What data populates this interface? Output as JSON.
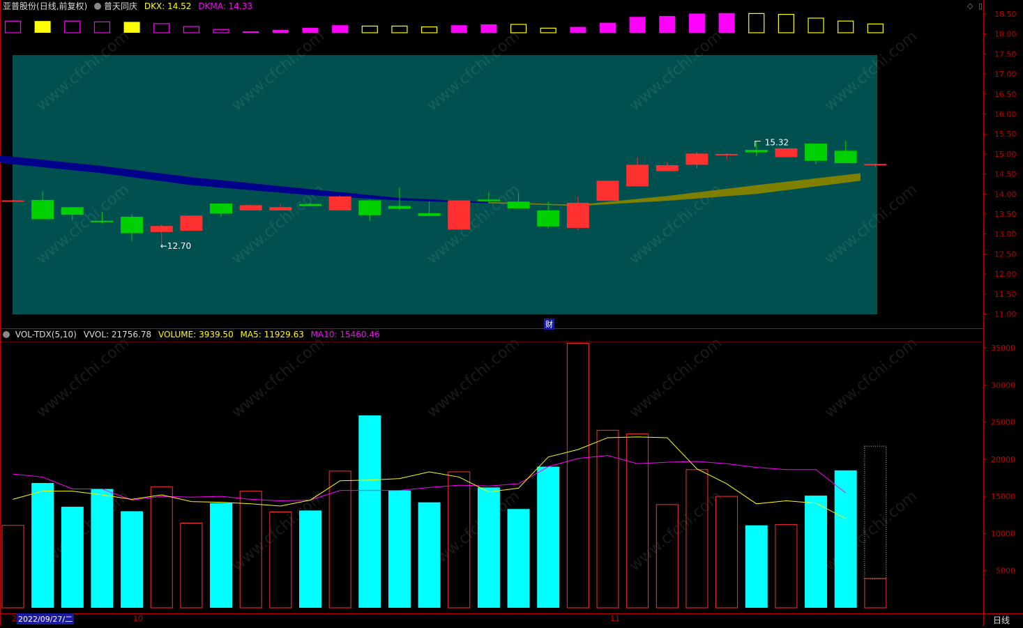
{
  "header": {
    "stock": "亚普股份",
    "mode": "(日线,前复权)",
    "indicator": "普天同庆",
    "dkx_label": "DKX:",
    "dkx_value": "14.52",
    "dkma_label": "DKMA:",
    "dkma_value": "14.33"
  },
  "volume_header": {
    "name": "VOL-TDX(5,10)",
    "vvol": "VVOL: 21756.78",
    "volume": "VOLUME: 3939.50",
    "ma5": "MA5: 11929.63",
    "ma10": "MA10: 15460.46"
  },
  "bottom": {
    "date": "2022/09/27/二",
    "tick_oct": "10",
    "tick_nov": "11",
    "period": "日线",
    "cai": "财",
    "left_tick": "2"
  },
  "watermark": "www.cfchi.com",
  "colors": {
    "up": "#ff3030",
    "down": "#00d000",
    "vol_down": "#00ffff",
    "ma5": "#ffff00",
    "ma10": "#ff00ff",
    "axis": "#c00000",
    "panel": "#005050"
  },
  "chart_data": [
    {
      "type": "candlestick",
      "annotations": [
        {
          "text": "←12.70",
          "value": 12.7
        },
        {
          "text": "15.32",
          "value": 15.32
        }
      ],
      "ylim": [
        11.0,
        18.5
      ],
      "y_ticks": [
        "18.50",
        "18.00",
        "17.50",
        "17.00",
        "16.50",
        "16.00",
        "15.50",
        "15.00",
        "14.50",
        "14.00",
        "13.50",
        "13.00",
        "12.50",
        "12.00",
        "11.50",
        "11.00"
      ],
      "candles": [
        {
          "o": 13.84,
          "c": 13.84,
          "h": 13.86,
          "l": 13.82
        },
        {
          "o": 13.85,
          "c": 13.37,
          "h": 14.07,
          "l": 13.37
        },
        {
          "o": 13.67,
          "c": 13.48,
          "h": 13.68,
          "l": 13.34
        },
        {
          "o": 13.33,
          "c": 13.3,
          "h": 13.54,
          "l": 13.26
        },
        {
          "o": 13.43,
          "c": 13.02,
          "h": 13.49,
          "l": 12.83
        },
        {
          "o": 13.05,
          "c": 13.2,
          "h": 13.24,
          "l": 12.7
        },
        {
          "o": 13.08,
          "c": 13.46,
          "h": 13.46,
          "l": 13.08
        },
        {
          "o": 13.76,
          "c": 13.51,
          "h": 13.77,
          "l": 13.43
        },
        {
          "o": 13.59,
          "c": 13.72,
          "h": 13.74,
          "l": 13.59
        },
        {
          "o": 13.59,
          "c": 13.67,
          "h": 13.74,
          "l": 13.59
        },
        {
          "o": 13.75,
          "c": 13.7,
          "h": 13.78,
          "l": 13.7
        },
        {
          "o": 13.59,
          "c": 13.94,
          "h": 13.96,
          "l": 13.59
        },
        {
          "o": 13.84,
          "c": 13.47,
          "h": 13.86,
          "l": 13.33
        },
        {
          "o": 13.7,
          "c": 13.63,
          "h": 14.16,
          "l": 13.59
        },
        {
          "o": 13.52,
          "c": 13.45,
          "h": 13.81,
          "l": 13.45
        },
        {
          "o": 13.11,
          "c": 13.84,
          "h": 13.84,
          "l": 13.11
        },
        {
          "o": 13.86,
          "c": 13.82,
          "h": 14.05,
          "l": 13.76
        },
        {
          "o": 13.81,
          "c": 13.64,
          "h": 14.02,
          "l": 13.64
        },
        {
          "o": 13.59,
          "c": 13.19,
          "h": 13.8,
          "l": 13.14
        },
        {
          "o": 13.15,
          "c": 13.78,
          "h": 13.93,
          "l": 13.09
        },
        {
          "o": 13.83,
          "c": 14.33,
          "h": 14.33,
          "l": 13.83
        },
        {
          "o": 14.19,
          "c": 14.73,
          "h": 14.92,
          "l": 14.19
        },
        {
          "o": 14.57,
          "c": 14.72,
          "h": 14.8,
          "l": 14.57
        },
        {
          "o": 14.73,
          "c": 15.01,
          "h": 15.05,
          "l": 14.64
        },
        {
          "o": 15.0,
          "c": 15.0,
          "h": 15.02,
          "l": 14.86
        },
        {
          "o": 15.1,
          "c": 15.04,
          "h": 15.32,
          "l": 14.94
        },
        {
          "o": 14.92,
          "c": 15.14,
          "h": 15.14,
          "l": 14.92
        },
        {
          "o": 15.26,
          "c": 14.83,
          "h": 15.26,
          "l": 14.74
        },
        {
          "o": 15.08,
          "c": 14.77,
          "h": 15.33,
          "l": 14.77
        },
        {
          "o": 14.72,
          "c": 14.75,
          "h": 14.76,
          "l": 14.66
        }
      ],
      "dkx_band": {
        "x_index": [
          -0.5,
          3,
          6,
          10,
          13,
          16,
          19,
          22,
          25,
          28.5
        ],
        "upper": [
          14.97,
          14.7,
          14.42,
          14.12,
          13.9,
          13.8,
          13.73,
          13.95,
          14.22,
          14.52
        ],
        "lower": [
          14.78,
          14.52,
          14.22,
          13.97,
          13.84,
          13.77,
          13.7,
          13.83,
          14.0,
          14.33
        ],
        "color_fall": "#00008b",
        "color_rise": "#808000"
      },
      "signal_boxes": [
        {
          "type": "hollow",
          "color": "#ff00ff",
          "h": 0.28
        },
        {
          "type": "filled",
          "color": "#ffff00",
          "h": 0.28
        },
        {
          "type": "hollow",
          "color": "#ff00ff",
          "h": 0.28
        },
        {
          "type": "hollow",
          "color": "#ff00ff",
          "h": 0.26
        },
        {
          "type": "filled",
          "color": "#ffff00",
          "h": 0.26
        },
        {
          "type": "hollow",
          "color": "#ff00ff",
          "h": 0.22
        },
        {
          "type": "hollow",
          "color": "#ff00ff",
          "h": 0.15
        },
        {
          "type": "hollow",
          "color": "#ff00ff",
          "h": 0.08
        },
        {
          "type": "filled",
          "color": "#ff00ff",
          "h": 0.02
        },
        {
          "type": "filled",
          "color": "#ff00ff",
          "h": 0.07
        },
        {
          "type": "filled",
          "color": "#ff00ff",
          "h": 0.12
        },
        {
          "type": "filled",
          "color": "#ff00ff",
          "h": 0.18
        },
        {
          "type": "hollow",
          "color": "#ffff00",
          "h": 0.16
        },
        {
          "type": "hollow",
          "color": "#ffff00",
          "h": 0.16
        },
        {
          "type": "hollow",
          "color": "#ffff00",
          "h": 0.14
        },
        {
          "type": "filled",
          "color": "#ff00ff",
          "h": 0.18
        },
        {
          "type": "filled",
          "color": "#ff00ff",
          "h": 0.2
        },
        {
          "type": "hollow",
          "color": "#ffff00",
          "h": 0.2
        },
        {
          "type": "hollow",
          "color": "#ffff00",
          "h": 0.11
        },
        {
          "type": "filled",
          "color": "#ff00ff",
          "h": 0.14
        },
        {
          "type": "filled",
          "color": "#ff00ff",
          "h": 0.24
        },
        {
          "type": "filled",
          "color": "#ff00ff",
          "h": 0.38
        },
        {
          "type": "filled",
          "color": "#ff00ff",
          "h": 0.4
        },
        {
          "type": "filled",
          "color": "#ff00ff",
          "h": 0.46
        },
        {
          "type": "filled",
          "color": "#ff00ff",
          "h": 0.47
        },
        {
          "type": "hollow",
          "color": "#ffff00",
          "h": 0.46
        },
        {
          "type": "hollow",
          "color": "#ffff00",
          "h": 0.44
        },
        {
          "type": "hollow",
          "color": "#ffff00",
          "h": 0.35
        },
        {
          "type": "hollow",
          "color": "#ffff00",
          "h": 0.28
        },
        {
          "type": "hollow",
          "color": "#ffff00",
          "h": 0.21
        }
      ]
    },
    {
      "type": "bar",
      "name": "VOL-TDX(5,10)",
      "ylim": [
        0,
        37000
      ],
      "y_ticks": [
        "35000",
        "30000",
        "25000",
        "20000",
        "15000",
        "10000",
        "5000"
      ],
      "volume": [
        11100,
        16800,
        13600,
        16000,
        13000,
        16300,
        11400,
        14100,
        15700,
        12900,
        13100,
        18400,
        25900,
        15800,
        14200,
        18300,
        16200,
        13300,
        19000,
        35600,
        23900,
        23400,
        13900,
        18600,
        15000,
        11100,
        11200,
        15100,
        18500,
        3939.5
      ],
      "up": [
        1,
        0,
        0,
        0,
        0,
        1,
        1,
        0,
        1,
        1,
        0,
        1,
        0,
        0,
        0,
        1,
        0,
        0,
        0,
        1,
        1,
        1,
        1,
        1,
        1,
        0,
        1,
        0,
        0,
        1
      ],
      "vvol_last": 21756.78,
      "ma5": [
        14600,
        15700,
        15700,
        15200,
        14600,
        15200,
        14300,
        14200,
        14000,
        13700,
        14500,
        17100,
        17200,
        17400,
        18300,
        17600,
        15600,
        16100,
        20300,
        21300,
        22900,
        23000,
        22900,
        18700,
        16700,
        14000,
        14400,
        14100,
        12000
      ],
      "ma10": [
        18000,
        17600,
        16000,
        16000,
        14500,
        15000,
        14900,
        15000,
        14600,
        14400,
        14500,
        15800,
        15800,
        15800,
        16200,
        16500,
        16400,
        16700,
        19000,
        20100,
        20500,
        19400,
        19600,
        19700,
        19400,
        18900,
        18600,
        18600,
        15460
      ]
    }
  ]
}
